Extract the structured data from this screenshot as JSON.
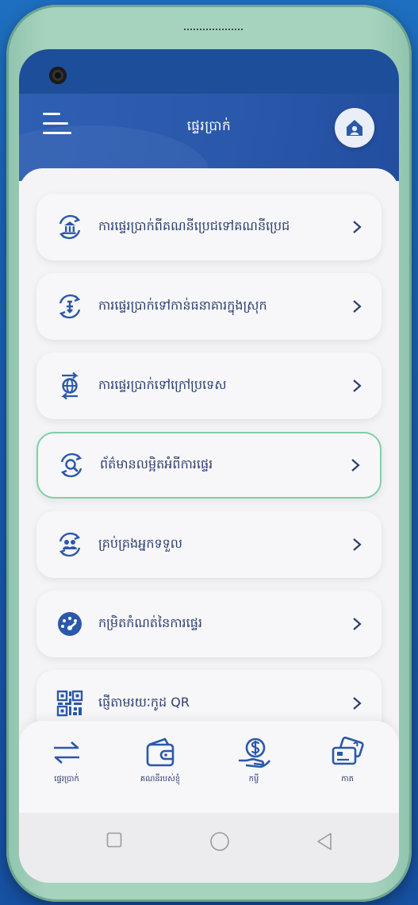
{
  "header": {
    "title": "ផ្ទេរប្រាក់"
  },
  "menu": {
    "items": [
      {
        "label": "ការផ្ទេរប្រាក់ពីគណនីប្រេជទៅគណនីប្រេជ",
        "icon": "bank-transfer-icon"
      },
      {
        "label": "ការផ្ទេរប្រាក់ទៅកាន់ធនាគារក្នុងស្រុក",
        "icon": "local-bank-transfer-icon"
      },
      {
        "label": "ការផ្ទេរប្រាក់ទៅក្រៅប្រទេស",
        "icon": "globe-transfer-icon"
      },
      {
        "label": "ព័ត៌មានលម្អិតអំពីការផ្ទេរ",
        "icon": "search-transfer-icon"
      },
      {
        "label": "គ្រប់គ្រងអ្នកទទួល",
        "icon": "manage-recipients-icon"
      },
      {
        "label": "កម្រិតកំណត់នៃការផ្ទេរ",
        "icon": "speedometer-icon"
      },
      {
        "label": "ផ្ញើតាមរយៈកូដ QR",
        "icon": "qr-code-icon"
      }
    ]
  },
  "bottom_nav": {
    "items": [
      {
        "label": "ផ្ទេរប្រាក់",
        "icon": "transfer-arrows-icon"
      },
      {
        "label": "គណនីរបស់ខ្ញុំ",
        "icon": "wallet-icon"
      },
      {
        "label": "កម្ចី",
        "icon": "loan-icon"
      },
      {
        "label": "កាត",
        "icon": "card-icon"
      }
    ]
  },
  "colors": {
    "header": "#2a58ab",
    "text": "#2c3e6e",
    "active_border": "#7fd0a5"
  }
}
